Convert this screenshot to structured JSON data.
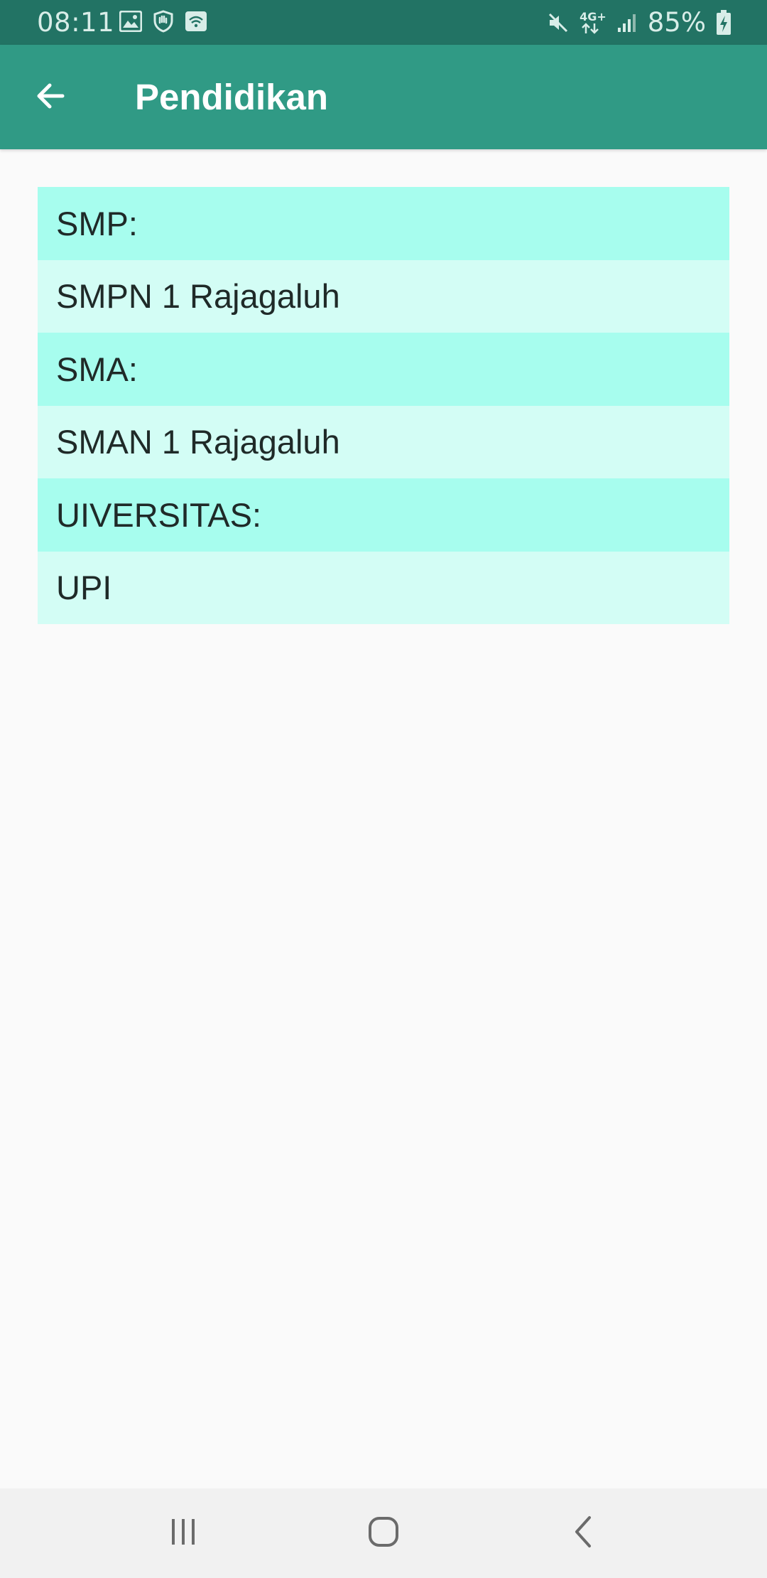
{
  "status_bar": {
    "time": "08:11",
    "network": "4G+",
    "battery": "85%",
    "icons": [
      "image-icon",
      "shield-hand-icon",
      "wifi-icon",
      "mute-icon",
      "network-4g-icon",
      "signal-icon",
      "battery-charging-icon"
    ]
  },
  "app_bar": {
    "title": "Pendidikan",
    "back_icon": "arrow-back-icon"
  },
  "education": {
    "rows": [
      {
        "label": "SMP:",
        "value": "SMPN 1 Rajagaluh"
      },
      {
        "label": "SMA:",
        "value": "SMAN 1 Rajagaluh"
      },
      {
        "label": "UIVERSITAS:",
        "value": "UPI"
      }
    ]
  },
  "nav_bar": {
    "icons": [
      "recent-apps-icon",
      "home-icon",
      "back-icon"
    ]
  },
  "colors": {
    "status_bar": "#227364",
    "app_bar": "#309a85",
    "label_row": "#a7fdee",
    "value_row": "#d3fdf5",
    "background": "#fafafa"
  }
}
